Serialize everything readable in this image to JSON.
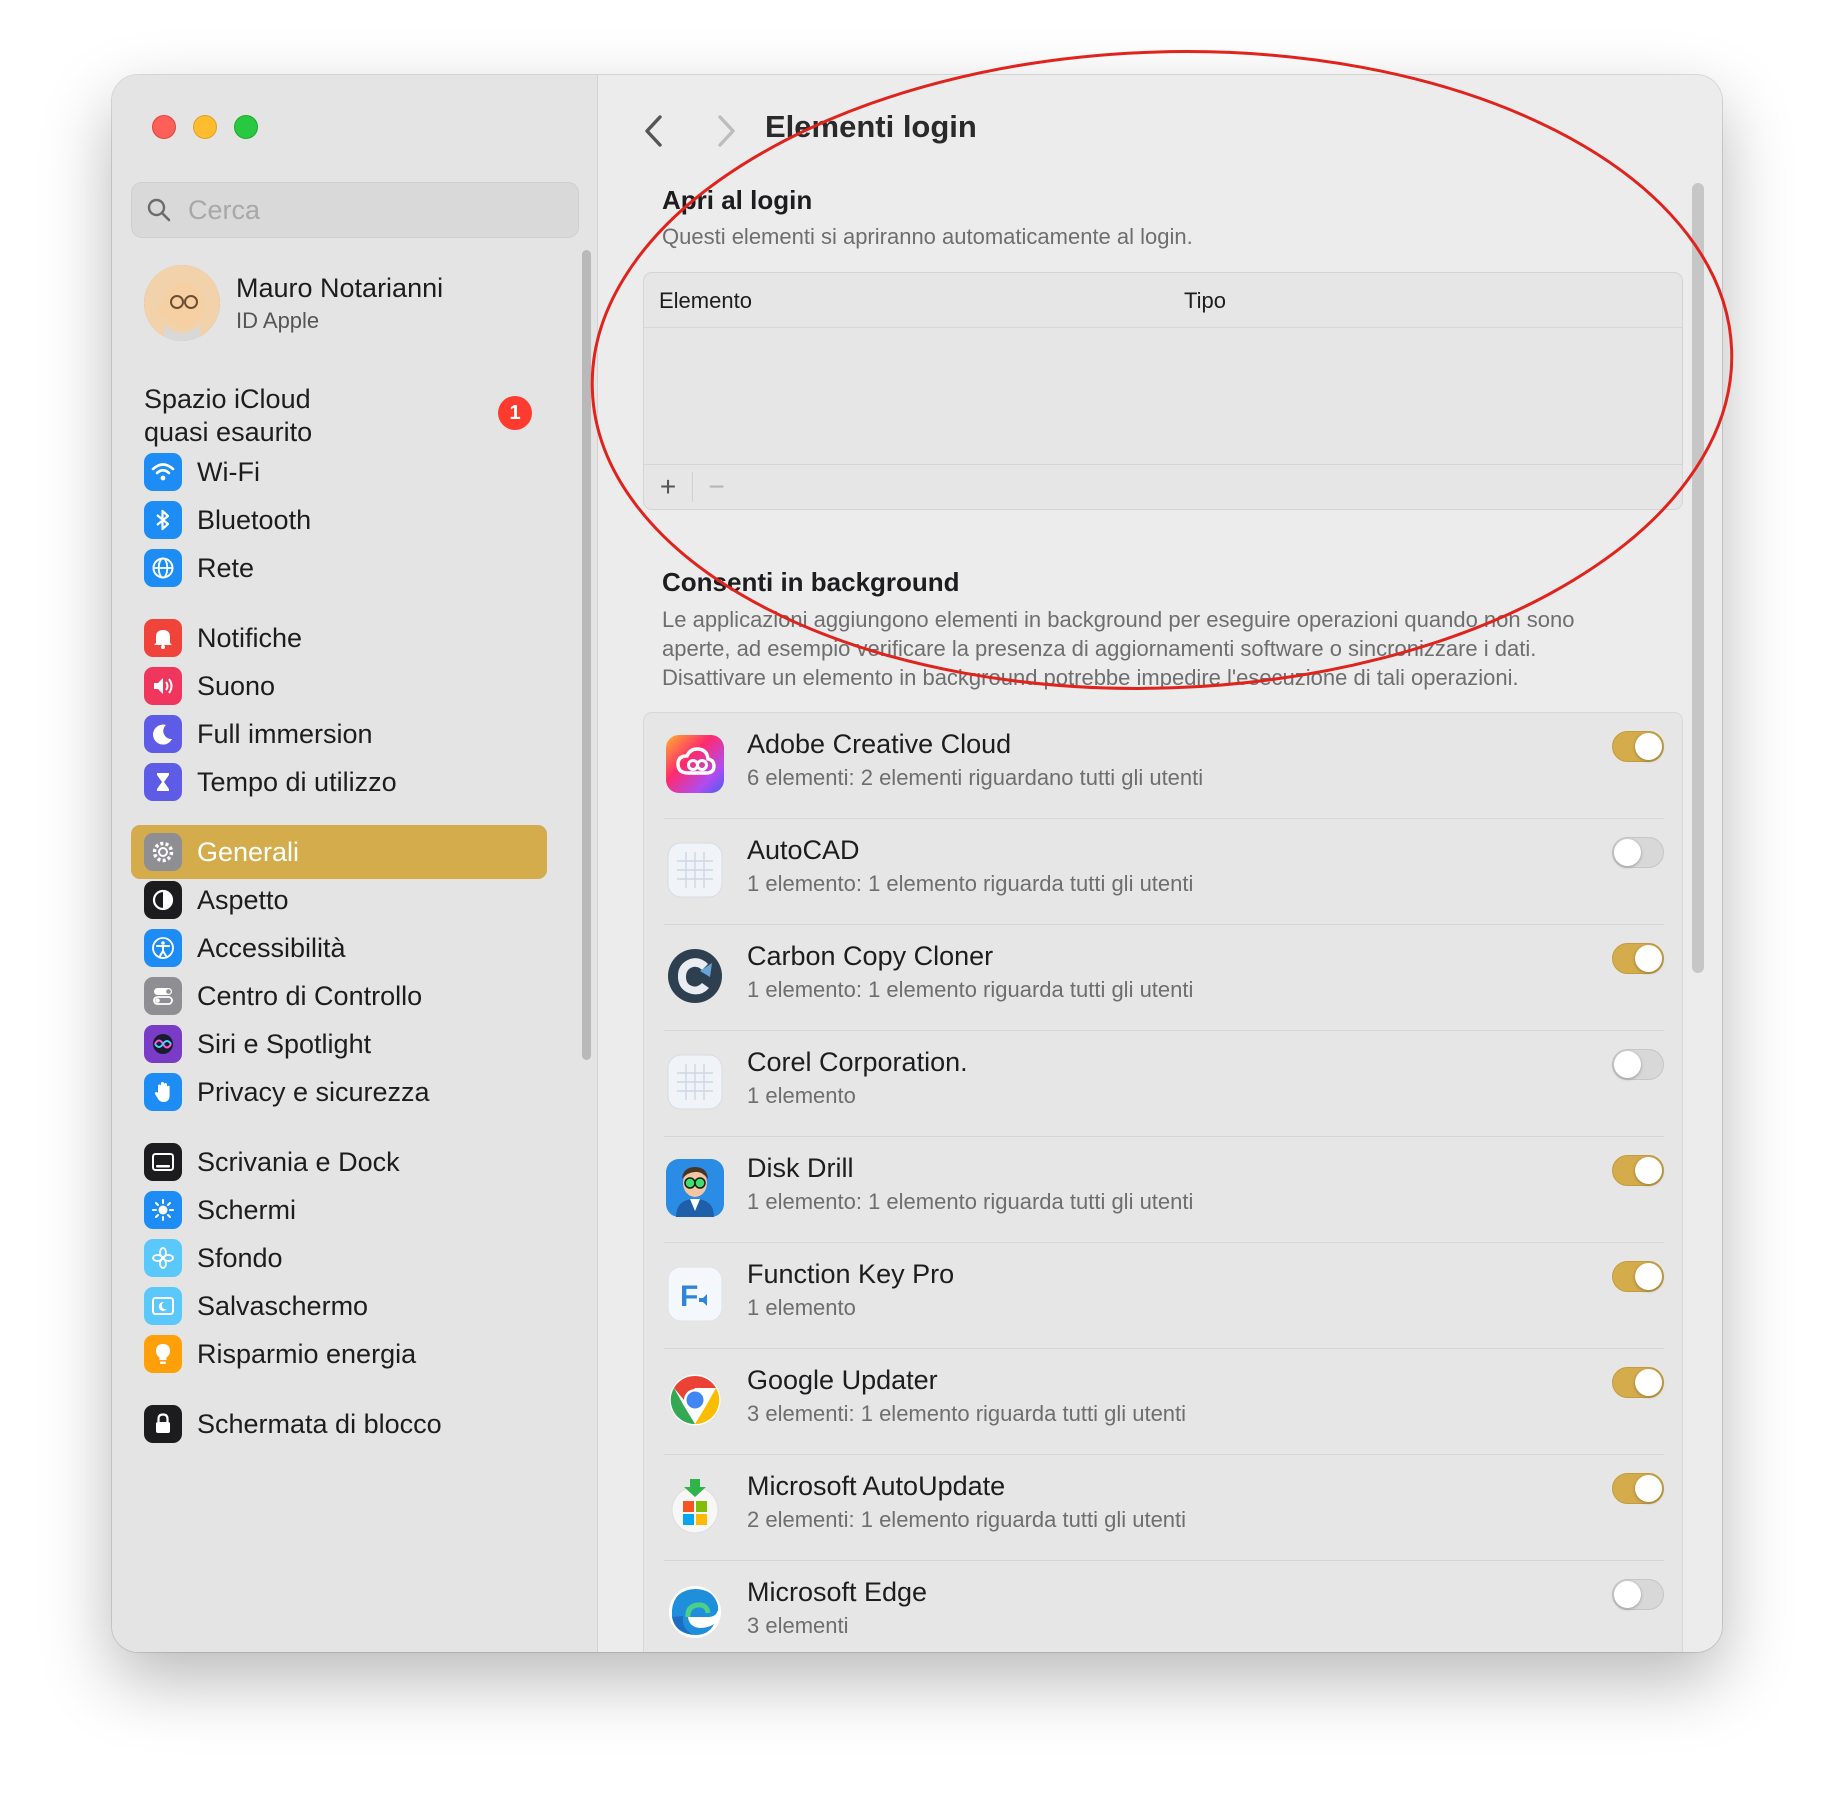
{
  "window": {
    "title": "Elementi login"
  },
  "sidebar": {
    "search_placeholder": "Cerca",
    "profile": {
      "name": "Mauro Notarianni",
      "subtitle": "ID Apple"
    },
    "icloud_notice": {
      "line1": "Spazio iCloud",
      "line2": "quasi esaurito",
      "badge": "1"
    },
    "items": [
      {
        "label": "Wi-Fi",
        "icon": "wifi-icon",
        "color": "#1e8cf5"
      },
      {
        "label": "Bluetooth",
        "icon": "bluetooth-icon",
        "color": "#1e8cf5"
      },
      {
        "label": "Rete",
        "icon": "globe-icon",
        "color": "#1e8cf5"
      },
      {
        "label": "Notifiche",
        "icon": "bell-icon",
        "color": "#f0433a"
      },
      {
        "label": "Suono",
        "icon": "speaker-icon",
        "color": "#f1365e"
      },
      {
        "label": "Full immersion",
        "icon": "moon-icon",
        "color": "#5e5ce6"
      },
      {
        "label": "Tempo di utilizzo",
        "icon": "hourglass-icon",
        "color": "#5e5ce6"
      },
      {
        "label": "Generali",
        "icon": "gear-icon",
        "color": "#8e8e93",
        "selected": true
      },
      {
        "label": "Aspetto",
        "icon": "appearance-icon",
        "color": "#1c1c1e"
      },
      {
        "label": "Accessibilità",
        "icon": "accessibility-icon",
        "color": "#1e8cf5"
      },
      {
        "label": "Centro di Controllo",
        "icon": "control-center-icon",
        "color": "#8e8e93"
      },
      {
        "label": "Siri e Spotlight",
        "icon": "siri-icon",
        "color": "#7a3cc7"
      },
      {
        "label": "Privacy e sicurezza",
        "icon": "hand-icon",
        "color": "#1e8cf5"
      },
      {
        "label": "Scrivania e Dock",
        "icon": "dock-icon",
        "color": "#1c1c1e"
      },
      {
        "label": "Schermi",
        "icon": "sun-icon",
        "color": "#1e8cf5"
      },
      {
        "label": "Sfondo",
        "icon": "flower-icon",
        "color": "#5ac8fa"
      },
      {
        "label": "Salvaschermo",
        "icon": "screensaver-icon",
        "color": "#5ac8fa"
      },
      {
        "label": "Risparmio energia",
        "icon": "lightbulb-icon",
        "color": "#ff9f0a"
      },
      {
        "label": "Schermata di blocco",
        "icon": "lock-icon",
        "color": "#1c1c1e"
      }
    ]
  },
  "main": {
    "login_section": {
      "title": "Apri al login",
      "description": "Questi elementi si apriranno automaticamente al login.",
      "columns": [
        "Elemento",
        "Tipo"
      ],
      "add_label": "+",
      "remove_label": "−"
    },
    "background_section": {
      "title": "Consenti in background",
      "description_lines": [
        "Le applicazioni aggiungono elementi in background per eseguire operazioni quando non sono",
        "aperte, ad esempio verificare la presenza di aggiornamenti software o sincronizzare i dati.",
        "Disattivare un elemento in background potrebbe impedire l'esecuzione di tali operazioni."
      ],
      "apps": [
        {
          "name": "Adobe Creative Cloud",
          "detail": "6 elementi: 2 elementi riguardano tutti gli utenti",
          "enabled": true,
          "icon": "creative-cloud-icon"
        },
        {
          "name": "AutoCAD",
          "detail": "1 elemento: 1 elemento riguarda tutti gli utenti",
          "enabled": false,
          "icon": "generic-app-icon"
        },
        {
          "name": "Carbon Copy Cloner",
          "detail": "1 elemento: 1 elemento riguarda tutti gli utenti",
          "enabled": true,
          "icon": "ccc-icon"
        },
        {
          "name": "Corel Corporation.",
          "detail": "1 elemento",
          "enabled": false,
          "icon": "generic-app-icon"
        },
        {
          "name": "Disk Drill",
          "detail": "1 elemento: 1 elemento riguarda tutti gli utenti",
          "enabled": true,
          "icon": "disk-drill-icon"
        },
        {
          "name": "Function Key Pro",
          "detail": "1 elemento",
          "enabled": true,
          "icon": "function-key-icon"
        },
        {
          "name": "Google Updater",
          "detail": "3 elementi: 1 elemento riguarda tutti gli utenti",
          "enabled": true,
          "icon": "chrome-icon"
        },
        {
          "name": "Microsoft AutoUpdate",
          "detail": "2 elementi: 1 elemento riguarda tutti gli utenti",
          "enabled": true,
          "icon": "ms-autoupdate-icon"
        },
        {
          "name": "Microsoft Edge",
          "detail": "3 elementi",
          "enabled": false,
          "icon": "edge-icon"
        }
      ]
    }
  },
  "colors": {
    "accent": "#d4ac4c",
    "annotation": "#e0231d",
    "badge": "#ff3b30"
  }
}
